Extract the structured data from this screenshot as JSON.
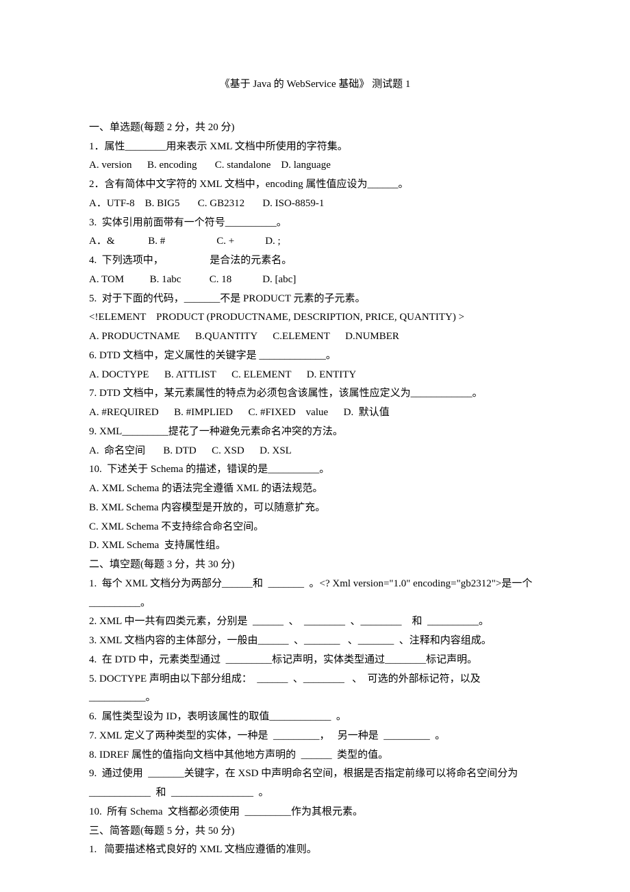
{
  "title": "《基于 Java 的 WebService 基础》  测试题 1",
  "sections": {
    "s1_header": "一、单选题(每题 2 分，共 20 分)",
    "q1": "1．属性________用来表示 XML 文档中所使用的字符集。",
    "q1_opts": "A. version      B. encoding       C. standalone    D. language",
    "q2": "2．含有简体中文字符的 XML 文档中，encoding 属性值应设为______。",
    "q2_opts": "A．UTF-8    B. BIG5       C. GB2312       D. ISO-8859-1",
    "q3": "3.  实体引用前面带有一个符号__________。",
    "q3_opts": "A．&             B. #                    C. +            D. ;",
    "q4": "4.  下列选项中，                  是合法的元素名。",
    "q4_opts": "A. TOM          B. 1abc           C. 18            D. [abc]",
    "q5": "5.  对于下面的代码，_______不是 PRODUCT 元素的子元素。",
    "q5_code": "<!ELEMENT    PRODUCT (PRODUCTNAME, DESCRIPTION, PRICE, QUANTITY) >",
    "q5_opts": "A. PRODUCTNAME      B.QUANTITY      C.ELEMENT      D.NUMBER",
    "q6": "6. DTD 文档中，定义属性的关键字是 _____________。",
    "q6_opts": "A. DOCTYPE      B. ATTLIST      C. ELEMENT      D. ENTITY",
    "q7": "7. DTD 文档中，某元素属性的特点为必须包含该属性，该属性应定义为____________。",
    "q7_opts": "A. #REQUIRED      B. #IMPLIED      C. #FIXED    value      D.  默认值",
    "q9": "9. XML_________提花了一种避免元素命名冲突的方法。",
    "q9_opts": "A.  命名空间       B. DTD      C. XSD      D. XSL",
    "q10": "10.  下述关于 Schema 的描述，错误的是__________。",
    "q10_a": "A. XML Schema 的语法完全遵循 XML 的语法规范。",
    "q10_b": "B. XML Schema 内容模型是开放的，可以随意扩充。",
    "q10_c": "C. XML Schema 不支持综合命名空间。",
    "q10_d": "D. XML Schema  支持属性组。",
    "s2_header": "二、填空题(每题 3 分，共 30 分)",
    "f1": "1.  每个 XML 文档分为两部分______和  _______  。<? Xml version=\"1.0\" encoding=\"gb2312\">是一个  __________。",
    "f2": "2. XML 中一共有四类元素，分别是  ______  、  ________  、________    和  __________。",
    "f3": "3. XML 文档内容的主体部分，一般由______  、_______   、_______  、注释和内容组成。",
    "f4": "4.  在 DTD 中，元素类型通过  _________标记声明，实体类型通过________标记声明。",
    "f5": "5. DOCTYPE 声明由以下部分组成：  ______  、________   、  可选的外部标记符，以及  ___________。",
    "f6": "6.  属性类型设为 ID，表明该属性的取值____________  。",
    "f7": "7. XML 定义了两种类型的实体，一种是  _________，   另一种是  _________  。",
    "f8": "8. IDREF 属性的值指向文档中其他地方声明的  ______  类型的值。",
    "f9": "9.  通过使用  _______关键字，在 XSD 中声明命名空间，根据是否指定前缘可以将命名空间分为  ____________  和  ________________  。",
    "f10": "10.  所有 Schema  文档都必须使用  _________作为其根元素。",
    "s3_header": "三、简答题(每题 5 分，共 50 分)",
    "sa1": "1.   简要描述格式良好的 XML 文档应遵循的准则。"
  }
}
